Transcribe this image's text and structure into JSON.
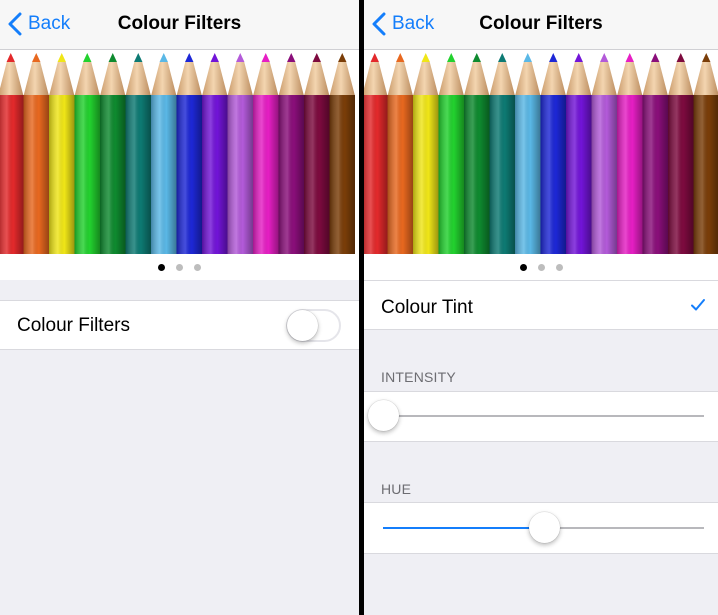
{
  "left": {
    "nav": {
      "back_label": "Back",
      "title": "Colour Filters"
    },
    "page_indicator": {
      "count": 3,
      "active": 0
    },
    "toggle_cell": {
      "label": "Colour Filters",
      "switch_on": false
    }
  },
  "right": {
    "nav": {
      "back_label": "Back",
      "title": "Colour Filters"
    },
    "page_indicator": {
      "count": 3,
      "active": 0
    },
    "selected_filter": {
      "label": "Colour Tint",
      "checked": true
    },
    "intensity": {
      "header": "INTENSITY",
      "value": 0.0
    },
    "hue": {
      "header": "HUE",
      "value": 0.5
    }
  },
  "colors": {
    "accent": "#147efb",
    "background": "#efeff4",
    "separator": "#000000"
  },
  "pencil_colors": [
    "#e3292b",
    "#e8681f",
    "#f0e617",
    "#22d12e",
    "#0e8a2f",
    "#0d7a73",
    "#5ab8e6",
    "#1d27d6",
    "#7214d8",
    "#b35ad9",
    "#e61ec4",
    "#8a0e7a",
    "#7d0a3e",
    "#7a3d08"
  ]
}
